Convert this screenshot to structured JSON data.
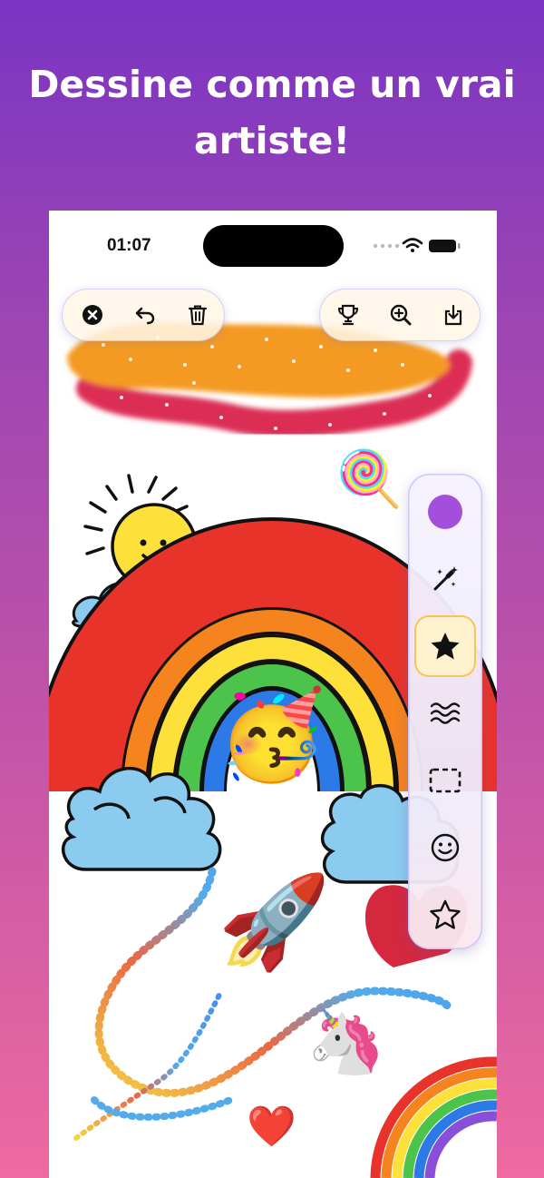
{
  "headline": {
    "line1": "Dessine comme un vrai",
    "line2": "artiste!"
  },
  "status_bar": {
    "time": "01:07"
  },
  "top_toolbar": {
    "left": [
      "close-icon",
      "undo-icon",
      "trash-icon"
    ],
    "right": [
      "trophy-icon",
      "zoom-in-icon",
      "download-icon"
    ]
  },
  "side_toolbar": {
    "selected_color": "#a44fdc",
    "tools": [
      "magic-wand-icon",
      "star-brush-icon",
      "waves-icon",
      "dashed-rect-icon",
      "smiley-icon",
      "star-outline-icon"
    ],
    "active_tool": "star-brush-icon"
  },
  "canvas_stickers": {
    "lollipop": "🍭",
    "party_face": "🥳",
    "rocket": "🚀",
    "heart": "❤️",
    "unicorn": "🦄"
  },
  "colors": {
    "rainbow": [
      "#e8332b",
      "#f5841f",
      "#fde13a",
      "#4cc34b",
      "#2c7ae8"
    ],
    "heart": "#e8364a",
    "accent": "#a44fdc"
  }
}
